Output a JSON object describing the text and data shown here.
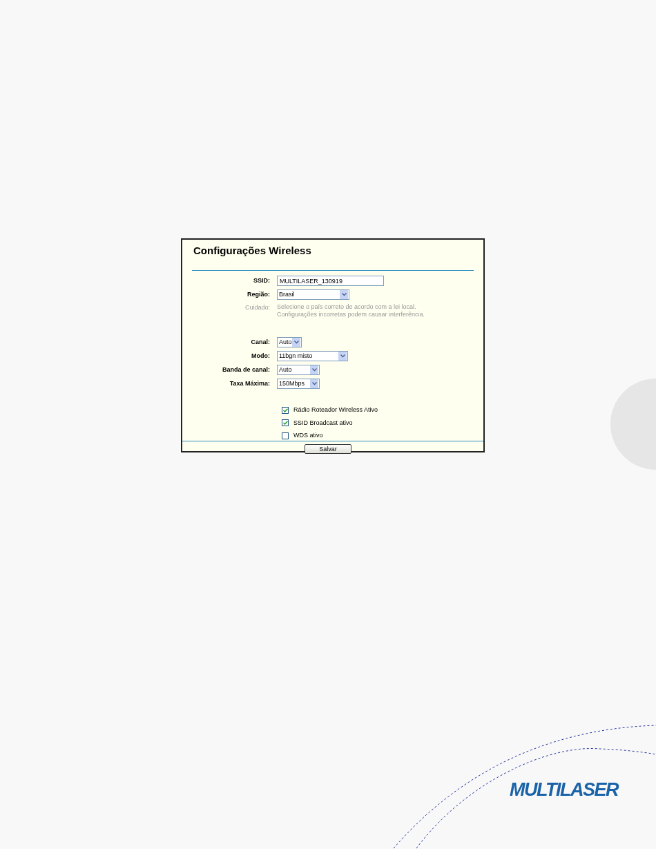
{
  "panel": {
    "title": "Configurações Wireless",
    "fields": [
      {
        "kind": "text",
        "label": "SSID:",
        "value": "MULTILASER_130919"
      },
      {
        "kind": "select",
        "label": "Região:",
        "value": "Brasil"
      },
      {
        "kind": "note",
        "label": "Cuidado:",
        "lines": [
          "Selecione o país correto de acordo com a lei local.",
          "Configurações incorretas podem causar interferência."
        ]
      },
      {
        "kind": "select",
        "label": "Canal:",
        "value": "Auto"
      },
      {
        "kind": "select",
        "label": "Modo:",
        "value": "11bgn misto"
      },
      {
        "kind": "select",
        "label": "Banda de canal:",
        "value": "Auto"
      },
      {
        "kind": "select",
        "label": "Taxa Máxima:",
        "value": "150Mbps"
      }
    ],
    "checkboxes": [
      {
        "label": "Rádio Roteador Wireless Ativo",
        "checked": true
      },
      {
        "label": "SSID Broadcast ativo",
        "checked": true
      },
      {
        "label": "WDS ativo",
        "checked": false
      }
    ],
    "button": "Salvar"
  },
  "logo": "MULTILASER"
}
